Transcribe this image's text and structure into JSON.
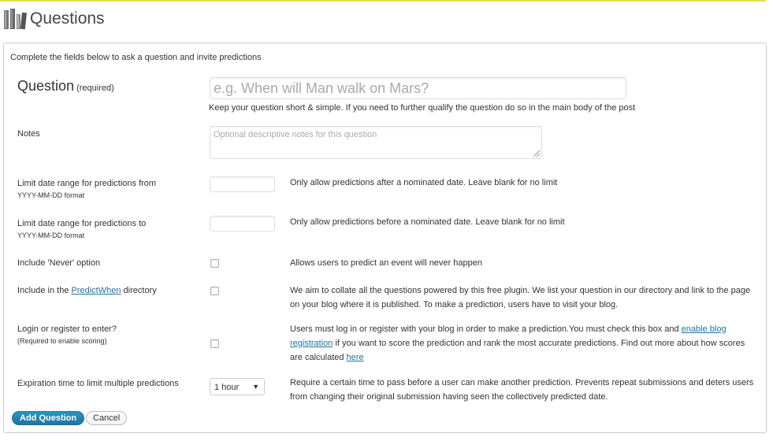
{
  "header": {
    "title": "Questions",
    "icon": "books-icon"
  },
  "form": {
    "intro": "Complete the fields below to ask a question and invite predictions",
    "question": {
      "label": "Question",
      "required_note": "(required)",
      "placeholder": "e.g. When will Man walk on Mars?",
      "help": "Keep your question short & simple. If you need to further qualify the question do so in the main body of the post"
    },
    "notes": {
      "label": "Notes",
      "placeholder": "Optional descriptive notes for this question"
    },
    "date_from": {
      "label": "Limit date range for predictions from",
      "format": "YYYY-MM-DD format",
      "value": "",
      "desc": "Only allow predictions after a nominated date. Leave blank for no limit"
    },
    "date_to": {
      "label": "Limit date range for predictions to",
      "format": "YYYY-MM-DD format",
      "value": "",
      "desc": "Only allow predictions before a nominated date. Leave blank for no limit"
    },
    "never_option": {
      "label": "Include 'Never' option",
      "checked": false,
      "desc": "Allows users to predict an event will never happen"
    },
    "directory": {
      "label_prefix": "Include in the ",
      "label_link": "PredictWhen",
      "label_suffix": " directory",
      "checked": false,
      "desc": "We aim to collate all the questions powered by this free plugin. We list your question in our directory and link to the page on your blog where it is published. To make a prediction, users have to visit your blog."
    },
    "login": {
      "label": "Login or register to enter?",
      "sublabel": "(Required to enable scoring)",
      "checked": false,
      "desc_part1": "Users must log in or register with your blog in order to make a prediction.You must check this box and ",
      "desc_link1": "enable blog registration",
      "desc_part2": " if you want to score the prediction and rank the most accurate predictions. Find out more about how scores are calculated ",
      "desc_link2": "here"
    },
    "expiration": {
      "label": "Expiration time to limit multiple predictions",
      "selected": "1 hour",
      "desc": "Require a certain time to pass before a user can make another prediction. Prevents repeat submissions and deters users from changing their original submission having seen the collectively predicted date."
    },
    "buttons": {
      "add": "Add Question",
      "cancel": "Cancel"
    }
  },
  "colors": {
    "accent": "#21759b",
    "notice_border": "#e6db55"
  }
}
